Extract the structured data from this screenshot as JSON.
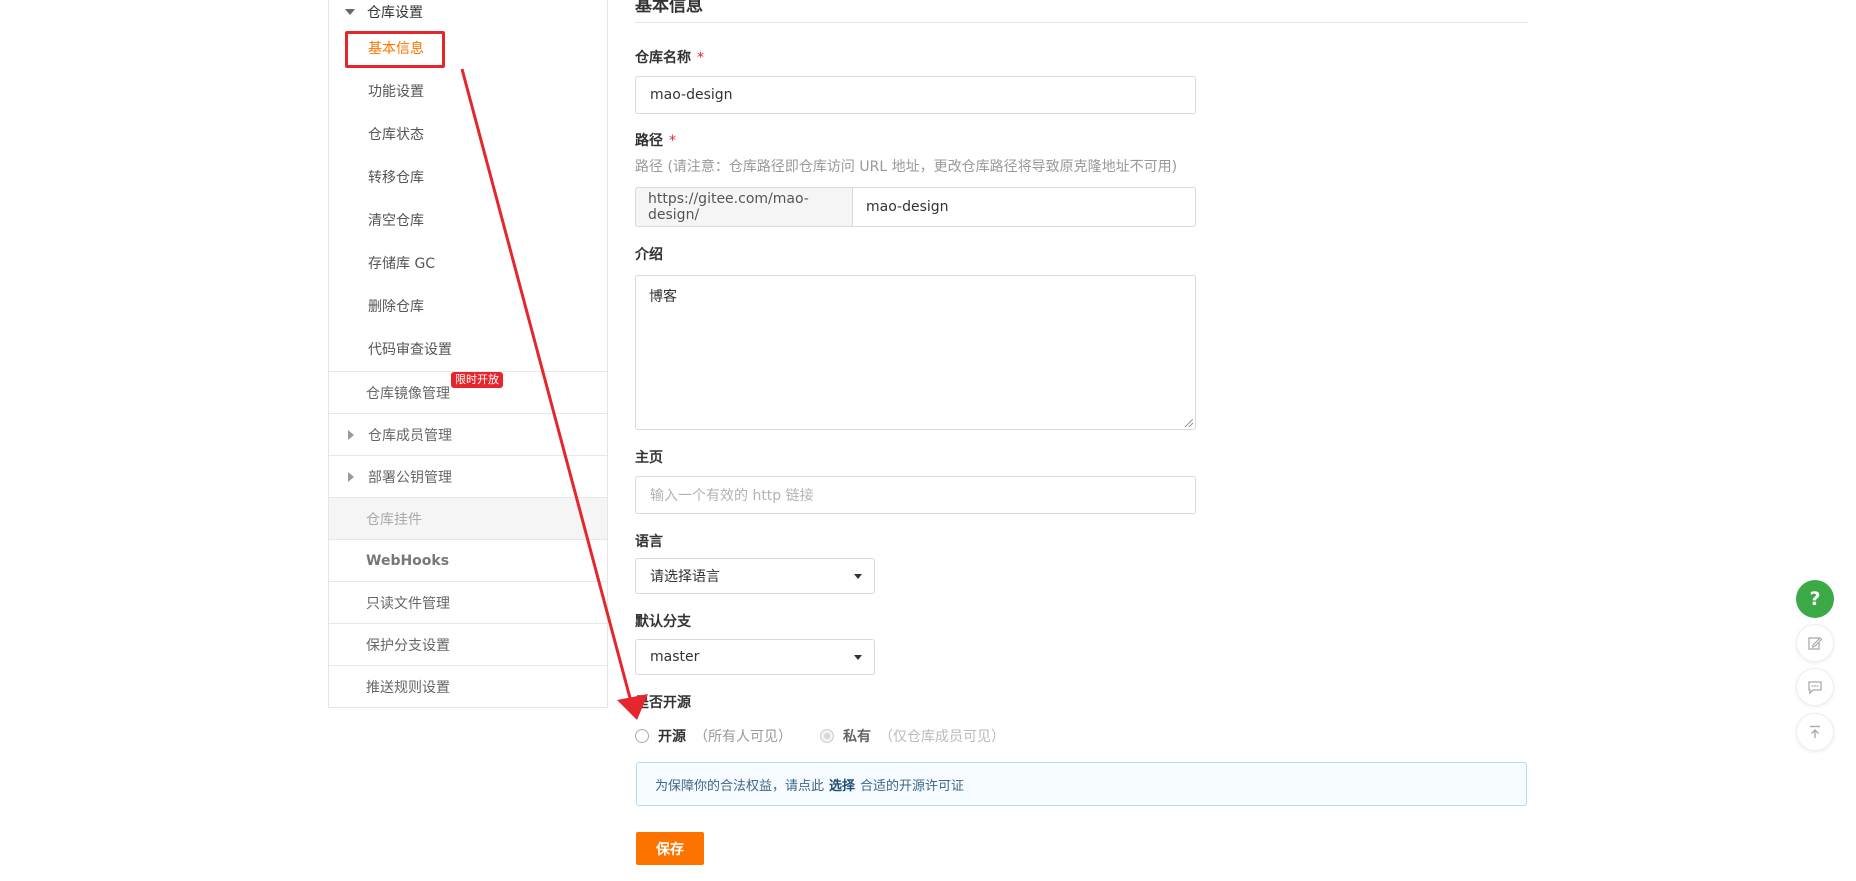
{
  "sidebar": {
    "group_title": "仓库设置",
    "sub_items": [
      {
        "label": "基本信息",
        "active": true
      },
      {
        "label": "功能设置"
      },
      {
        "label": "仓库状态"
      },
      {
        "label": "转移仓库"
      },
      {
        "label": "清空仓库"
      },
      {
        "label": "存储库 GC"
      },
      {
        "label": "删除仓库"
      },
      {
        "label": "代码审查设置"
      }
    ],
    "items": [
      {
        "label": "仓库镜像管理",
        "badge": "限时开放"
      },
      {
        "label": "仓库成员管理"
      },
      {
        "label": "部署公钥管理"
      },
      {
        "label": "仓库挂件"
      },
      {
        "label": "WebHooks"
      },
      {
        "label": "只读文件管理"
      },
      {
        "label": "保护分支设置"
      },
      {
        "label": "推送规则设置"
      }
    ]
  },
  "main": {
    "page_title": "基本信息",
    "repo_name": {
      "label": "仓库名称",
      "required_mark": "*",
      "value": "mao-design"
    },
    "path": {
      "label": "路径",
      "required_mark": "*",
      "hint": "路径 (请注意：仓库路径即仓库访问 URL 地址，更改仓库路径将导致原克隆地址不可用)",
      "prefix": "https://gitee.com/mao-design/",
      "value": "mao-design"
    },
    "intro": {
      "label": "介绍",
      "value": "博客"
    },
    "homepage": {
      "label": "主页",
      "placeholder": "输入一个有效的 http 链接"
    },
    "language": {
      "label": "语言",
      "value": "请选择语言"
    },
    "default_branch": {
      "label": "默认分支",
      "value": "master"
    },
    "visibility": {
      "label": "是否开源",
      "options": [
        {
          "label": "开源",
          "desc": "（所有人可见）",
          "selected": false,
          "disabled": false
        },
        {
          "label": "私有",
          "desc": "（仅仓库成员可见）",
          "selected": true,
          "disabled": true
        }
      ]
    },
    "notice": {
      "before": "为保障你的合法权益，请点此",
      "link": "选择",
      "after": "合适的开源许可证"
    },
    "save_label": "保存"
  },
  "floating": {
    "help": "?",
    "icons": [
      "edit-icon",
      "comment-icon",
      "back-to-top-icon"
    ]
  },
  "colors": {
    "accent": "#fe7300",
    "annotation_red": "#e5262d",
    "help_green": "#3aa946"
  }
}
